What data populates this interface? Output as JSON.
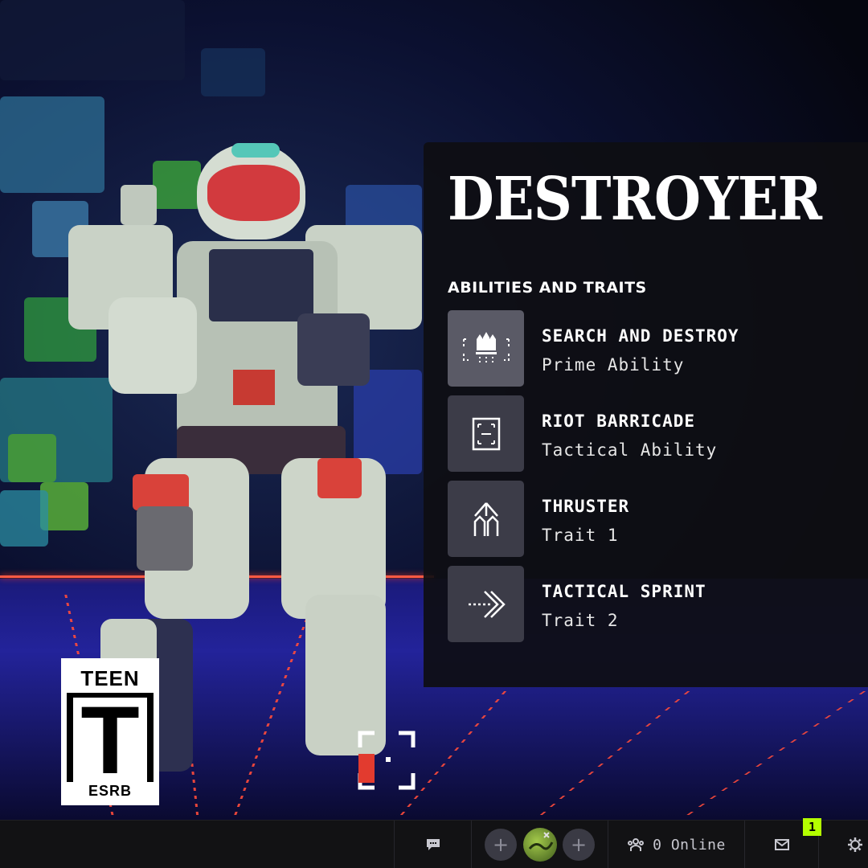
{
  "panel": {
    "title": "DESTROYER",
    "section_label": "ABILITIES AND TRAITS",
    "abilities": [
      {
        "name": "SEARCH AND DESTROY",
        "type": "Prime Ability",
        "icon": "search-and-destroy-icon"
      },
      {
        "name": "RIOT BARRICADE",
        "type": "Tactical Ability",
        "icon": "riot-barricade-icon"
      },
      {
        "name": "THRUSTER",
        "type": "Trait 1",
        "icon": "thruster-icon"
      },
      {
        "name": "TACTICAL SPRINT",
        "type": "Trait 2",
        "icon": "tactical-sprint-icon"
      }
    ]
  },
  "rating": {
    "top": "TEEN",
    "letter": "T",
    "bottom": "ESRB"
  },
  "bottom_bar": {
    "online_text": "0 Online",
    "notification_count": "1"
  },
  "colors": {
    "accent": "#b4ff00",
    "panel_bg": "#0e0e12",
    "ability_icon_bg": "#3c3c48",
    "bar_bg": "#121214"
  }
}
